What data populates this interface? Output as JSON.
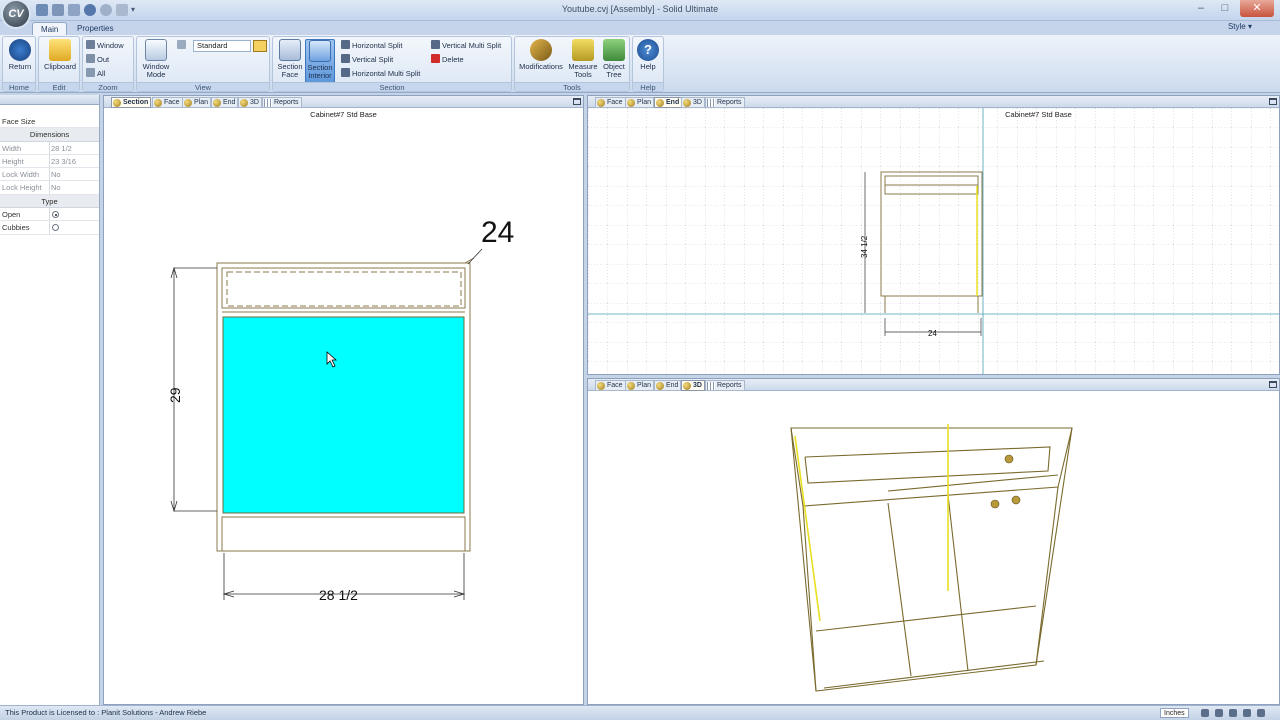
{
  "window": {
    "title": "Youtube.cvj [Assembly] - Solid Ultimate",
    "logo": "CV",
    "close_symbol": "✕",
    "minimize_symbol": "–",
    "maximize_symbol": "□"
  },
  "ribbon_tabs": [
    "Main",
    "Properties"
  ],
  "style_menu": "Style ▾",
  "ribbon": {
    "home_group": "Home",
    "edit_group": "Edit",
    "zoom_group": "Zoom",
    "view_group": "View",
    "section_group": "Section",
    "tools_group": "Tools",
    "help_group": "Help",
    "return_label": "Return",
    "clipboard_label": "Clipboard",
    "zoom_window": "Window",
    "zoom_out": "Out",
    "zoom_all": "All",
    "window_mode_1": "Window",
    "window_mode_2": "Mode",
    "view_select": "Standard",
    "section_face_1": "Section",
    "section_face_2": "Face",
    "section_interior_1": "Section",
    "section_interior_2": "Interior",
    "horizontal_split": "Horizontal Split",
    "vertical_split": "Vertical Split",
    "horizontal_multi_split": "Horizontal Multi Split",
    "vertical_multi_split": "Vertical Multi Split",
    "delete": "Delete",
    "modifications": "Modifications",
    "measure_tools_1": "Measure",
    "measure_tools_2": "Tools",
    "object_tree_1": "Object",
    "object_tree_2": "Tree",
    "help_label": "Help"
  },
  "properties": {
    "title": "Face Size",
    "dimensions_header": "Dimensions",
    "rows": [
      {
        "name": "Width",
        "value": "28 1/2"
      },
      {
        "name": "Height",
        "value": "23 3/16"
      },
      {
        "name": "Lock Width",
        "value": "No"
      },
      {
        "name": "Lock Height",
        "value": "No"
      }
    ],
    "type_header": "Type",
    "type_options": [
      {
        "name": "Open",
        "selected": true
      },
      {
        "name": "Cubbies",
        "selected": false
      }
    ]
  },
  "section_view": {
    "tabs": [
      "Section",
      "Face",
      "Plan",
      "End",
      "3D",
      "Reports"
    ],
    "active_tab": "Section",
    "title": "Cabinet#7 Std Base",
    "dim_width": "28 1/2",
    "dim_height": "29",
    "dim_depth": "24",
    "highlight_color": "#00ffff"
  },
  "end_view": {
    "tabs": [
      "Face",
      "Plan",
      "End",
      "3D",
      "Reports"
    ],
    "active_tab": "End",
    "title": "Cabinet#7 Std Base",
    "dim_height": "34 1/2",
    "dim_depth": "24"
  },
  "view_3d": {
    "tabs": [
      "Face",
      "Plan",
      "End",
      "3D",
      "Reports"
    ],
    "active_tab": "3D"
  },
  "status": {
    "text": "This Product is Licensed to : Planit Solutions - Andrew Riebe",
    "units": "Inches"
  }
}
